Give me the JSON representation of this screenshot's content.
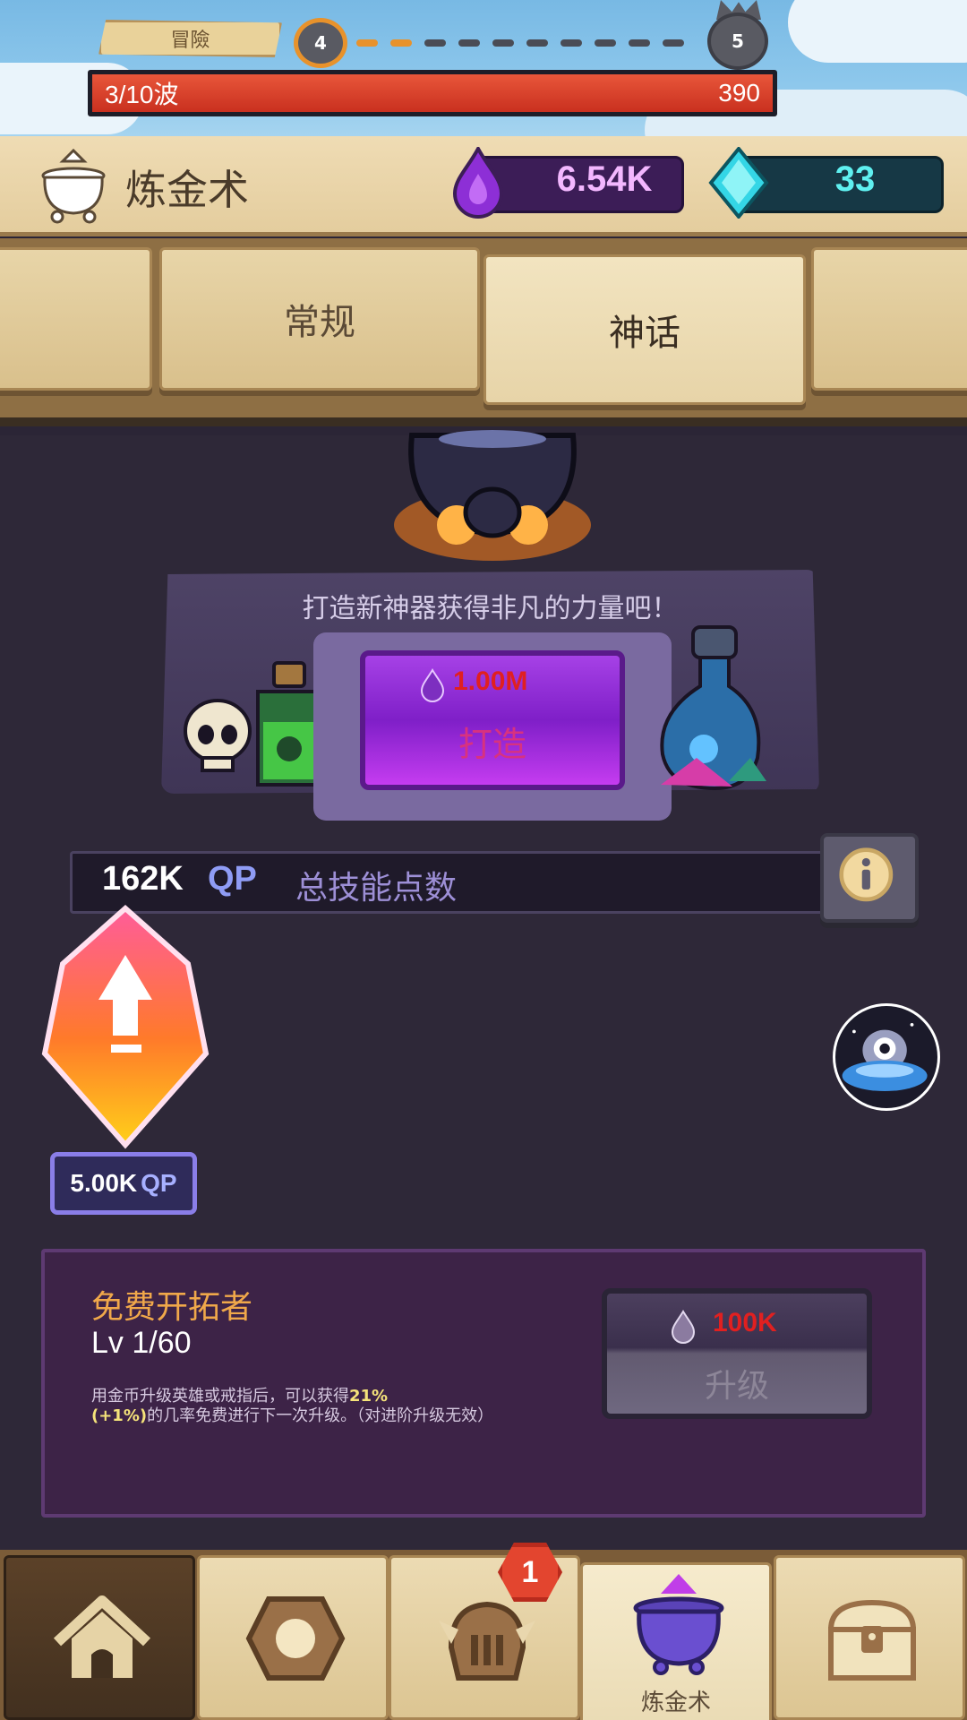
{
  "top": {
    "adventure_label": "冒險",
    "stage_current": "4",
    "stage_next": "5",
    "wave_label": "3/10波",
    "wave_hp": "390"
  },
  "header": {
    "title": "炼金术",
    "elixir": "6.54K",
    "gems": "33"
  },
  "tabs": [
    {
      "label": ""
    },
    {
      "label": "常规"
    },
    {
      "label": "神话",
      "active": true
    },
    {
      "label": ""
    }
  ],
  "forge": {
    "title": "打造新神器获得非凡的力量吧！",
    "cost": "1.00M",
    "button_label": "打造"
  },
  "qp": {
    "value": "162K",
    "unit": "QP",
    "label": "总技能点数"
  },
  "crystal": {
    "cost": "5.00K",
    "unit": "QP"
  },
  "skill": {
    "name": "免费开拓者",
    "level": "Lv 1/60",
    "desc_pre": "用金币升级英雄或戒指后，可以获得",
    "desc_highlight_1": "21%",
    "desc_highlight_2": "(+1%)",
    "desc_post": "的几率免费进行下一次升级。（对进阶升级无效）",
    "upgrade_cost": "100K",
    "upgrade_label": "升级"
  },
  "nav": {
    "active_label": "炼金术",
    "badge": "1"
  },
  "colors": {
    "accent_purple": "#a641e6",
    "cost_red": "#e02020",
    "gem_cyan": "#5ff0f0",
    "parchment": "#e8d5a8"
  }
}
